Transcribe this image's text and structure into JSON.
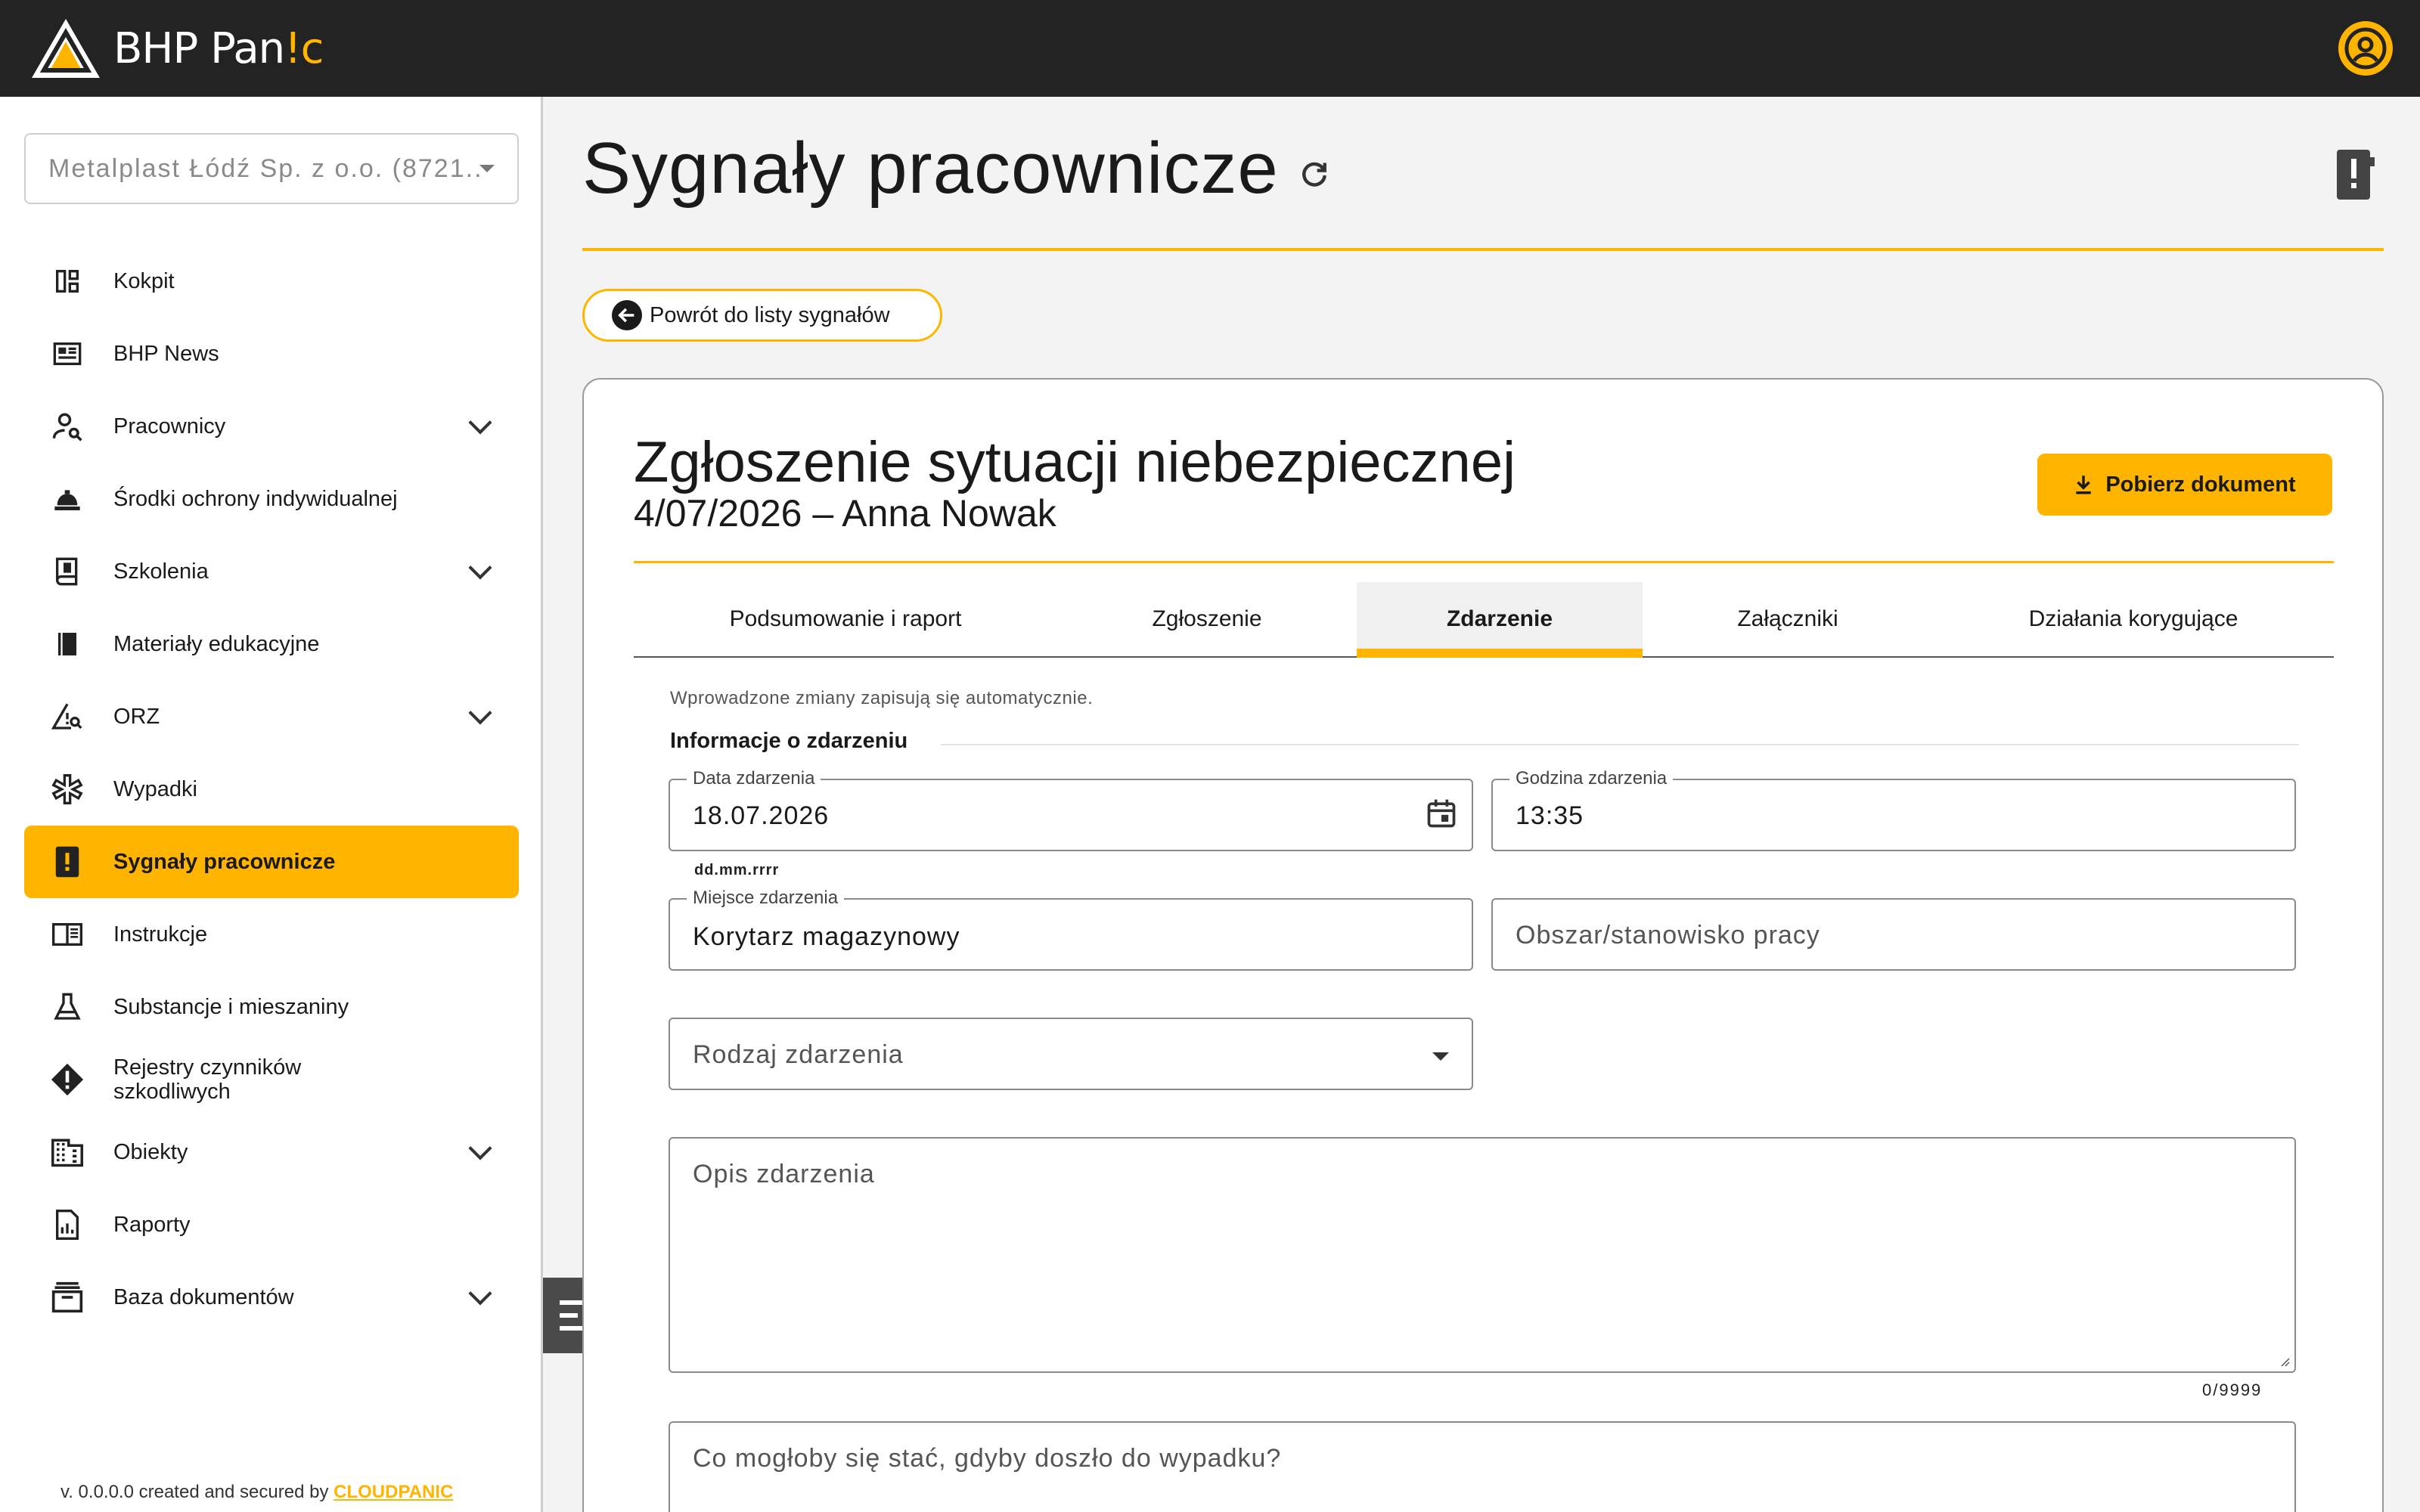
{
  "app": {
    "logo_text": "BHP Pan",
    "logo_accent": "!c",
    "accent_color": "#ffb400",
    "topbar_color": "#232323",
    "user_icon": "account-circle-icon"
  },
  "sidebar": {
    "company": "Metalplast Łódź Sp. z o.o. (8721...",
    "items": [
      {
        "label": "Kokpit",
        "icon": "dashboard-icon",
        "expandable": false
      },
      {
        "label": "BHP News",
        "icon": "newspaper-icon",
        "expandable": false
      },
      {
        "label": "Pracownicy",
        "icon": "person-search-icon",
        "expandable": true
      },
      {
        "label": "Środki ochrony indywidualnej",
        "icon": "helmet-icon",
        "expandable": false
      },
      {
        "label": "Szkolenia",
        "icon": "training-book-icon",
        "expandable": true
      },
      {
        "label": "Materiały edukacyjne",
        "icon": "book-icon",
        "expandable": false
      },
      {
        "label": "ORZ",
        "icon": "risk-warning-icon",
        "expandable": true
      },
      {
        "label": "Wypadki",
        "icon": "medical-star-icon",
        "expandable": false
      },
      {
        "label": "Sygnały pracownicze",
        "icon": "report-signal-icon",
        "expandable": false,
        "active": true
      },
      {
        "label": "Instrukcje",
        "icon": "instruction-book-icon",
        "expandable": false
      },
      {
        "label": "Substancje i mieszaniny",
        "icon": "flask-icon",
        "expandable": false
      },
      {
        "label": "Rejestry czynników szkodliwych",
        "icon": "warning-diamond-icon",
        "expandable": false
      },
      {
        "label": "Obiekty",
        "icon": "building-icon",
        "expandable": true
      },
      {
        "label": "Raporty",
        "icon": "report-chart-icon",
        "expandable": false
      },
      {
        "label": "Baza dokumentów",
        "icon": "archive-icon",
        "expandable": true
      }
    ],
    "version_text": "v. 0.0.0.0 created and secured by",
    "version_brand": "CLOUDPANIC"
  },
  "main": {
    "title": "Sygnały pracownicze",
    "back_label": "Powrót do listy sygnałów",
    "card": {
      "title": "Zgłoszenie sytuacji niebezpiecznej",
      "subtitle": "4/07/2026 – Anna Nowak",
      "download_label": "Pobierz dokument",
      "tabs": [
        {
          "label": "Podsumowanie i raport"
        },
        {
          "label": "Zgłoszenie"
        },
        {
          "label": "Zdarzenie",
          "active": true
        },
        {
          "label": "Załączniki"
        },
        {
          "label": "Działania korygujące"
        }
      ],
      "autosave_note": "Wprowadzone zmiany zapisują się automatycznie.",
      "section_title": "Informacje o zdarzeniu",
      "fields": {
        "date": {
          "label": "Data zdarzenia",
          "value": "18.07.2026",
          "hint": "dd.mm.rrrr"
        },
        "time": {
          "label": "Godzina zdarzenia",
          "value": "13:35"
        },
        "place": {
          "label": "Miejsce zdarzenia",
          "value": "Korytarz magazynowy"
        },
        "area": {
          "placeholder": "Obszar/stanowisko pracy"
        },
        "type": {
          "placeholder": "Rodzaj zdarzenia"
        },
        "description": {
          "placeholder": "Opis zdarzenia",
          "counter": "0/9999"
        },
        "consequence": {
          "placeholder": "Co mogłoby się stać, gdyby doszło do wypadku?"
        }
      }
    }
  }
}
